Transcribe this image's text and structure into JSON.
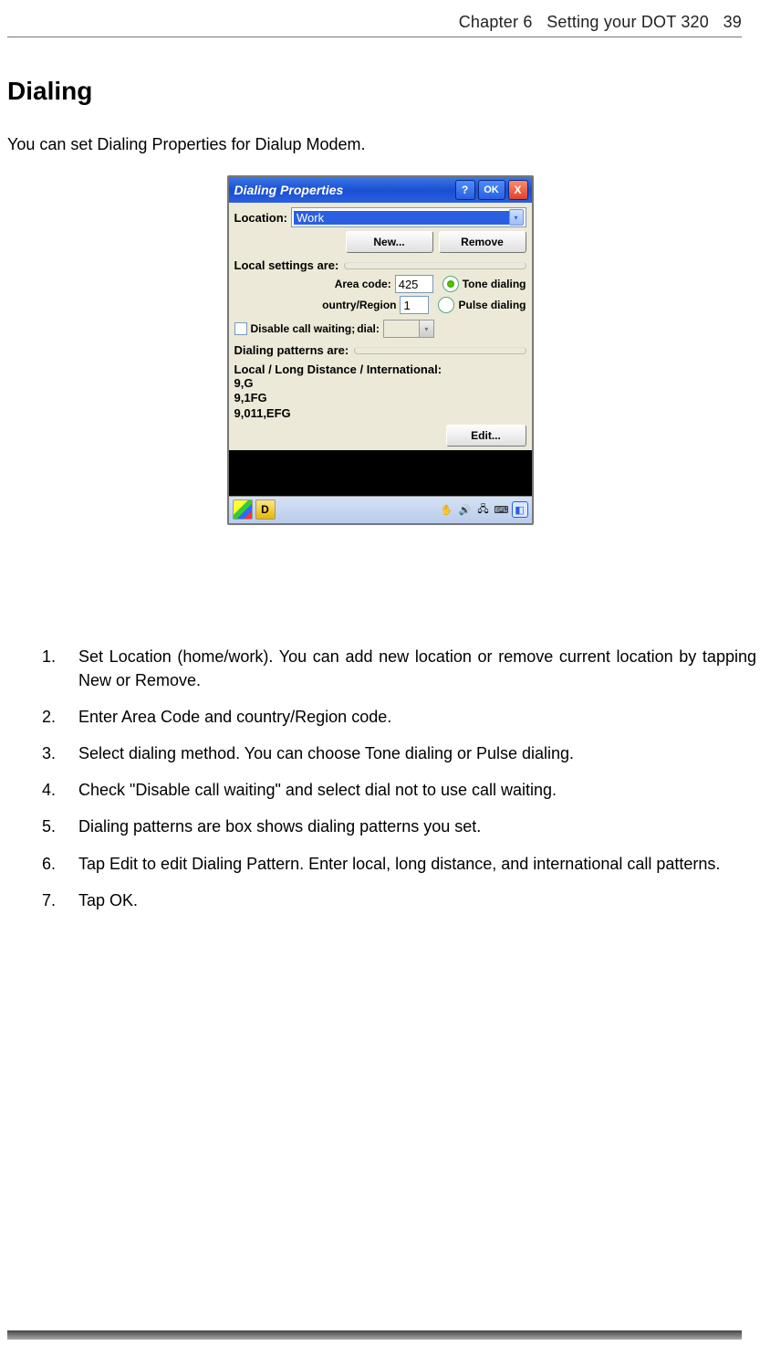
{
  "header": {
    "chapter": "Chapter 6",
    "title": "Setting your DOT 320",
    "page": "39"
  },
  "section": {
    "heading": "Dialing",
    "intro": "You can set Dialing Properties for Dialup Modem."
  },
  "dialog": {
    "title": "Dialing Properties",
    "ok": "OK",
    "help": "?",
    "close": "X",
    "location_label": "Location:",
    "location_value": "Work",
    "new_btn": "New...",
    "remove_btn": "Remove",
    "local_settings_hdr": "Local settings are:",
    "area_code_label": "Area code:",
    "area_code_value": "425",
    "country_label": "ountry/Region",
    "country_value": "1",
    "tone_label": "Tone dialing",
    "pulse_label": "Pulse dialing",
    "disable_cw_label": "Disable call waiting;",
    "dial_label": "dial:",
    "patterns_hdr": "Dialing patterns are:",
    "patterns_sub": "Local / Long Distance / International:",
    "pattern1": "9,G",
    "pattern2": "9,1FG",
    "pattern3": "9,011,EFG",
    "edit_btn": "Edit...",
    "taskbar_d": "D"
  },
  "steps": [
    "Set Location (home/work). You can add new location or remove current location by tapping New or Remove.",
    "Enter Area Code and country/Region code.",
    "Select dialing method. You can choose Tone dialing or Pulse dialing.",
    "Check \"Disable call waiting\" and select dial not to use call waiting.",
    "Dialing patterns are box shows dialing patterns you set.",
    "Tap Edit to edit Dialing Pattern. Enter local, long distance, and international call patterns.",
    "Tap OK."
  ]
}
